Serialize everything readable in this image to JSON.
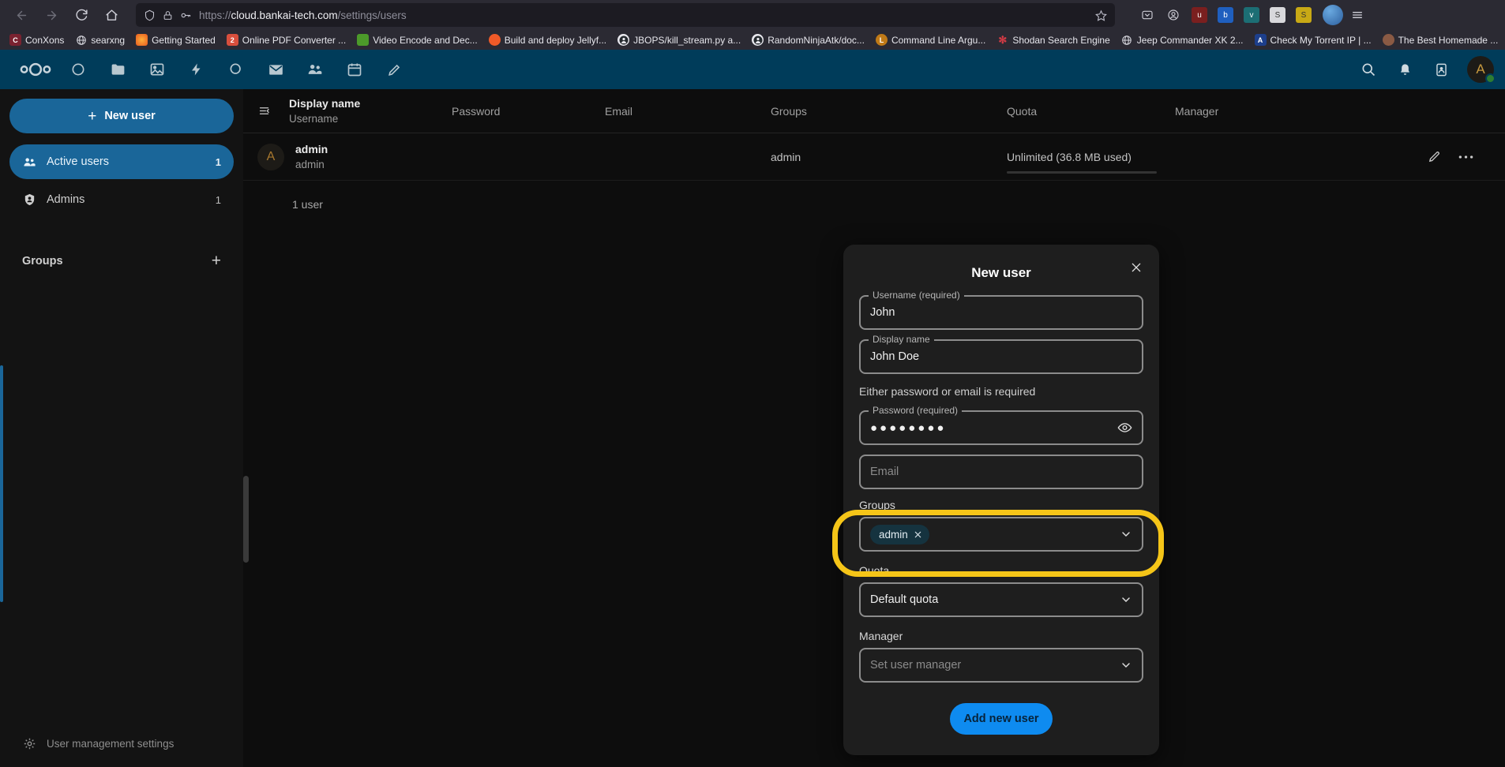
{
  "browser": {
    "url_scheme": "https://",
    "url_domain": "cloud.bankai-tech.com",
    "url_path": "/settings/users",
    "nav": {
      "back": "back-arrow",
      "forward": "forward-arrow",
      "reload": "reload",
      "home": "home"
    },
    "bookmarks": [
      {
        "label": "ConXons",
        "color": "#7a2230"
      },
      {
        "label": "searxng",
        "color": "#2b2a33"
      },
      {
        "label": "Getting Started",
        "color": "#e8591f"
      },
      {
        "label": "Online PDF Converter ...",
        "color": "#d94f3d"
      },
      {
        "label": "Video Encode and Dec...",
        "color": "#4c9a2a"
      },
      {
        "label": "Build and deploy Jellyf...",
        "color": "#f05a28"
      },
      {
        "label": "JBOPS/kill_stream.py a...",
        "color": "#24292e"
      },
      {
        "label": "RandomNinjaAtk/doc...",
        "color": "#24292e"
      },
      {
        "label": "Command Line Argu...",
        "color": "#c07a17"
      },
      {
        "label": "Shodan Search Engine",
        "color": "#d33b45"
      },
      {
        "label": "Jeep Commander XK 2...",
        "color": "#2b2a33"
      },
      {
        "label": "Check My Torrent IP | ...",
        "color": "#1d3f8c"
      },
      {
        "label": "The Best Homemade ...",
        "color": "#8a5a44"
      }
    ],
    "overflow_label": "»"
  },
  "nextcloud_header": {
    "logo": "nextcloud-logo",
    "apps": [
      "dashboard-icon",
      "files-icon",
      "photos-icon",
      "activity-icon",
      "search-app-icon",
      "mail-icon",
      "contacts-icon",
      "calendar-icon",
      "notes-icon"
    ],
    "right_icons": [
      "search-icon",
      "notifications-icon",
      "contacts-menu-icon"
    ],
    "avatar_initial": "A"
  },
  "sidebar": {
    "new_user_label": "New user",
    "items": [
      {
        "label": "Active users",
        "count": "1",
        "icon": "group-icon",
        "active": true
      },
      {
        "label": "Admins",
        "count": "1",
        "icon": "shield-account-icon",
        "active": false
      }
    ],
    "groups_heading": "Groups",
    "groups_add": "+",
    "footer_label": "User management settings"
  },
  "table": {
    "columns": {
      "name_primary": "Display name",
      "name_secondary": "Username",
      "password": "Password",
      "email": "Email",
      "groups": "Groups",
      "quota": "Quota",
      "manager": "Manager"
    },
    "rows": [
      {
        "avatar_initial": "A",
        "display_name": "admin",
        "username": "admin",
        "password": "",
        "email": "",
        "groups": "admin",
        "quota": "Unlimited (36.8 MB used)",
        "manager": ""
      }
    ],
    "count_label": "1 user"
  },
  "modal": {
    "title": "New user",
    "close_label": "×",
    "username": {
      "label": "Username (required)",
      "value": "John"
    },
    "display_name": {
      "label": "Display name",
      "value": "John Doe"
    },
    "hint": "Either password or email is required",
    "password": {
      "label": "Password (required)",
      "value": "●●●●●●●●"
    },
    "email": {
      "label": "",
      "placeholder": "Email",
      "value": ""
    },
    "groups": {
      "label": "Groups",
      "chips": [
        "admin"
      ],
      "chip_remove": "×"
    },
    "quota": {
      "label": "Quota",
      "value": "Default quota"
    },
    "manager": {
      "label": "Manager",
      "placeholder": "Set user manager",
      "value": ""
    },
    "submit_label": "Add new user"
  },
  "annotation": {
    "highlight_color": "#f5c518",
    "highlight_target": "groups-field"
  },
  "colors": {
    "nc_header": "#003c5a",
    "accent_blue": "#1a6699",
    "primary_button": "#0e8bf0",
    "sidebar_bg": "#131313",
    "main_bg": "#0d0d0d",
    "modal_bg": "#1e1e1e"
  }
}
